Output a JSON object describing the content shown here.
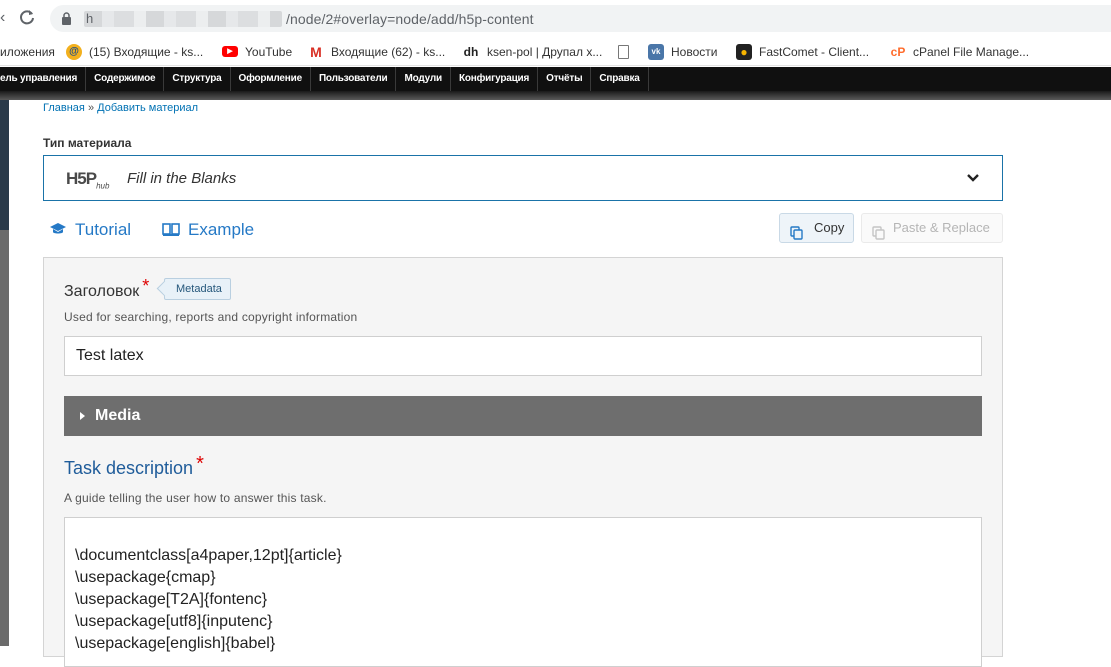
{
  "browser": {
    "url_host_initial": "h",
    "url_path": "/node/2#overlay=node/add/h5p-content",
    "bookmarks": [
      {
        "label": "иложения",
        "icon": "apps-icon"
      },
      {
        "label": "(15) Входящие - ks...",
        "icon": "mail-at-icon",
        "color": "#f2b01e"
      },
      {
        "label": "YouTube",
        "icon": "youtube-icon",
        "color": "#ff0000"
      },
      {
        "label": "Входящие (62) - ks...",
        "icon": "gmail-icon",
        "color": "#d93025"
      },
      {
        "label": "ksen-pol | Друпал х...",
        "icon": "dh-icon"
      },
      {
        "label": "",
        "icon": "page-icon"
      },
      {
        "label": "Новости",
        "icon": "vk-icon",
        "color": "#4a76a8"
      },
      {
        "label": "FastComet - Client...",
        "icon": "fastcomet-icon",
        "color": "#f7b500"
      },
      {
        "label": "cPanel File Manage...",
        "icon": "cpanel-icon",
        "color": "#ff6c2c"
      }
    ]
  },
  "admin_menu": [
    "ель управления",
    "Содержимое",
    "Структура",
    "Оформление",
    "Пользователи",
    "Модули",
    "Конфигурация",
    "Отчёты",
    "Справка"
  ],
  "breadcrumb": {
    "home": "Главная",
    "sep": "»",
    "current": "Добавить материал"
  },
  "type_label": "Тип материала",
  "hub": {
    "logo": "H5P",
    "logo_sub": "hub",
    "selected": "Fill in the Blanks"
  },
  "links": {
    "tutorial": "Tutorial",
    "example": "Example"
  },
  "buttons": {
    "copy": "Copy",
    "paste": "Paste & Replace"
  },
  "form": {
    "title_label": "Заголовок",
    "required_mark": "*",
    "metadata": "Metadata",
    "title_desc": "Used for searching, reports and copyright information",
    "title_value": "Test latex",
    "media": "Media",
    "task_label": "Task description",
    "task_desc": "A guide telling the user how to answer this task.",
    "task_lines": [
      "\\documentclass[a4paper,12pt]{article}",
      "\\usepackage{cmap}",
      "\\usepackage[T2A]{fontenc}",
      "\\usepackage[utf8]{inputenc}",
      "\\usepackage[english]{babel}"
    ]
  }
}
